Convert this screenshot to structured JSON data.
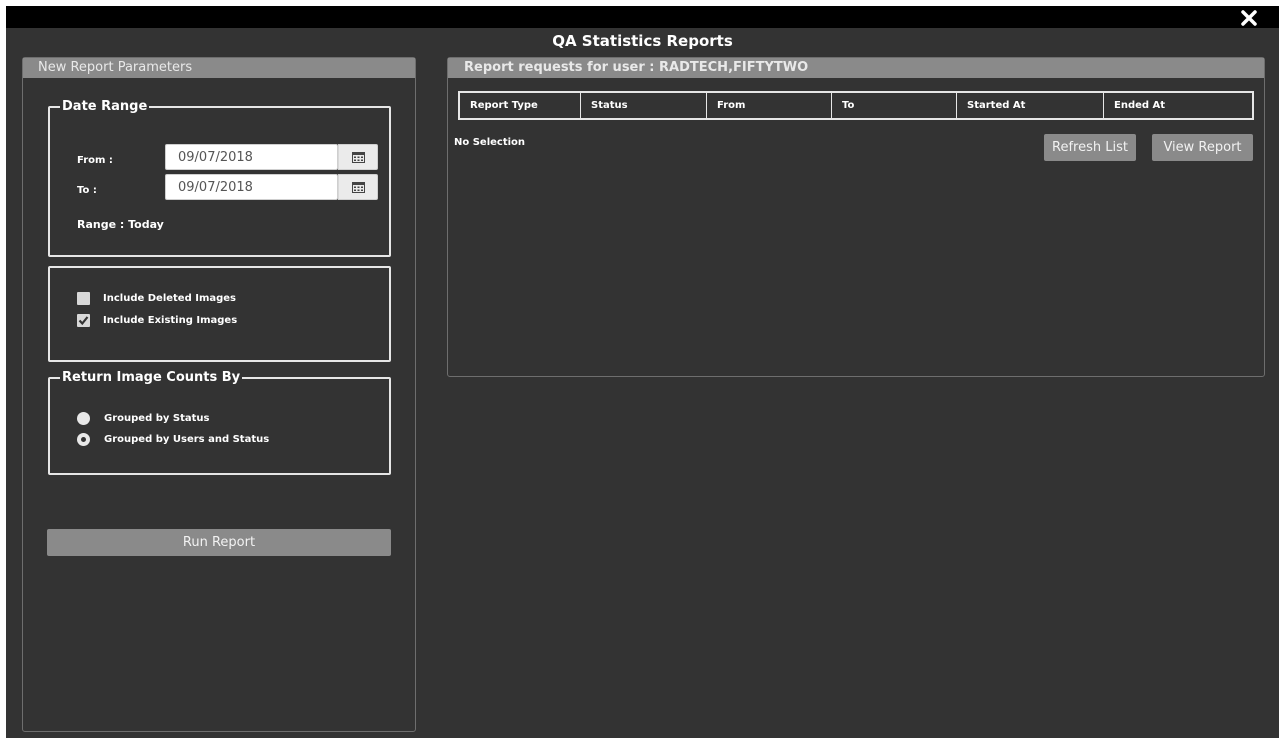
{
  "window": {
    "close_icon": "close-icon"
  },
  "app": {
    "title": "QA Statistics Reports"
  },
  "left_panel": {
    "header": "New Report Parameters",
    "date_range": {
      "legend": "Date Range",
      "from_label": "From :",
      "from_value": "09/07/2018",
      "to_label": "To :",
      "to_value": "09/07/2018",
      "range_text": "Range : Today",
      "calendar_icon": "calendar-icon"
    },
    "options": {
      "include_deleted_label": "Include Deleted Images",
      "include_deleted_checked": false,
      "include_existing_label": "Include Existing Images",
      "include_existing_checked": true
    },
    "return_counts": {
      "legend": "Return Image Counts By",
      "option1_label": "Grouped by Status",
      "option2_label": "Grouped by Users and Status",
      "selected": "Grouped by Users and Status"
    },
    "run_button": "Run Report"
  },
  "right_panel": {
    "header": "Report requests for user : RADTECH,FIFTYTWO",
    "columns": [
      "Report Type",
      "Status",
      "From",
      "To",
      "Started At",
      "Ended At"
    ],
    "no_selection": "No Selection",
    "refresh_button": "Refresh List",
    "view_button": "View Report"
  },
  "colors": {
    "background": "#333333",
    "panel_header": "#8a8a8a",
    "button": "#8a8a8a"
  }
}
